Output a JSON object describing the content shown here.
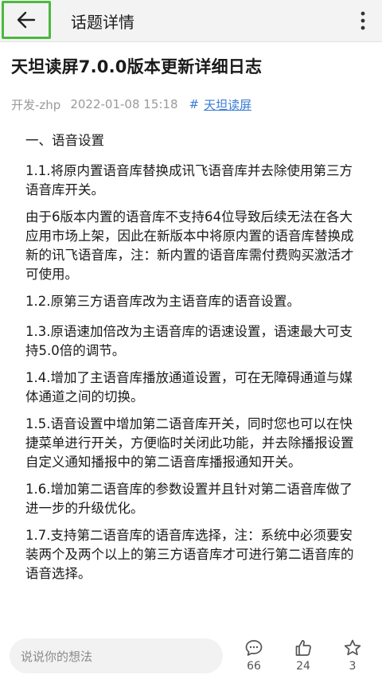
{
  "header": {
    "title": "话题详情",
    "icons": {
      "back": "arrow-left-icon",
      "more": "more-vertical-icon"
    }
  },
  "article": {
    "title": "天坦读屏7.0.0版本更新详细日志",
    "author": "开发-zhp",
    "datetime": "2022-01-08 15:18",
    "topic_tag": "天坦读屏",
    "paragraphs": [
      "一、语音设置",
      "1.1.将原内置语音库替换成讯飞语音库并去除使用第三方语音库开关。",
      "由于6版本内置的语音库不支持64位导致后续无法在各大应用市场上架，因此在新版本中将原内置的语音库替换成新的讯飞语音库，注：新内置的语音库需付费购买激活才可使用。",
      "1.2.原第三方语音库改为主语音库的语音设置。",
      "1.3.原语速加倍改为主语音库的语速设置，语速最大可支持5.0倍的调节。",
      "1.4.增加了主语音库播放通道设置，可在无障碍通道与媒体通道之间的切换。",
      "1.5.语音设置中增加第二语音库开关，同时您也可以在快捷菜单进行开关，方便临时关闭此功能，并去除播报设置 自定义通知播报中的第二语音库播报通知开关。",
      "1.6.增加第二语音库的参数设置并且针对第二语音库做了进一步的升级优化。",
      "1.7.支持第二语音库的语音库选择，注：系统中必须要安装两个及两个以上的第三方语音库才可进行第二语音库的语音选择。"
    ]
  },
  "bottom_bar": {
    "comment_placeholder": "说说你的想法",
    "comments_count": "66",
    "likes_count": "24",
    "favorites_count": "3",
    "icons": {
      "comment": "comment-icon",
      "like": "thumbs-up-icon",
      "favorite": "star-icon"
    }
  },
  "colors": {
    "accent_link": "#3a7bd5",
    "focus_border": "#4cb83f",
    "header_bg": "#f3f3f3"
  }
}
